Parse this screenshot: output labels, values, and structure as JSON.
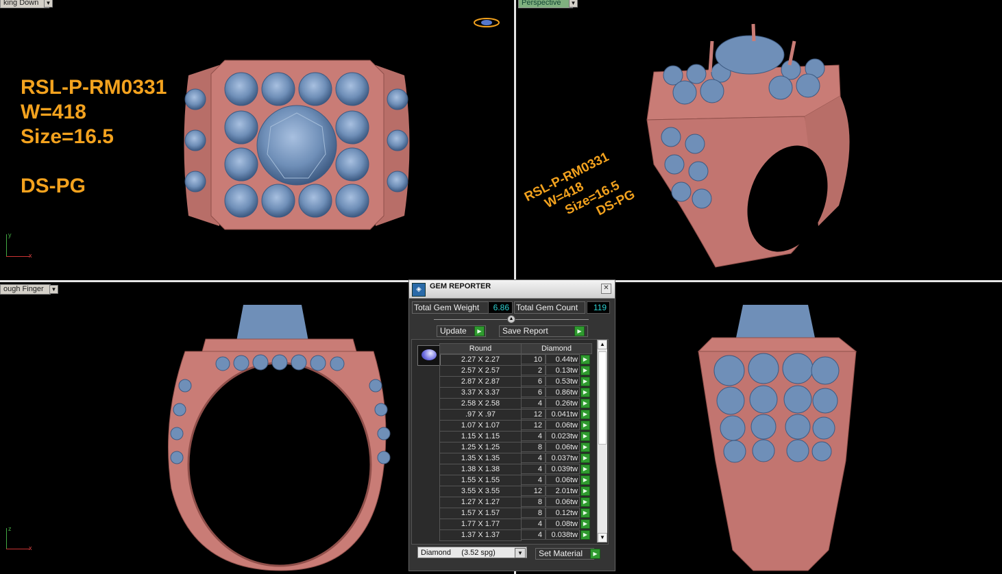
{
  "viewports": {
    "top_left_label": "king Down",
    "top_right_label": "Perspective",
    "bottom_left_label": "ough Finger"
  },
  "ring_info": {
    "code": "RSL-P-RM0331",
    "weight": "W=418",
    "size": "Size=16.5",
    "code2": "DS-PG"
  },
  "axis_labels": {
    "tl_y": "y",
    "tl_x": "x",
    "bl_z": "z",
    "bl_x": "x"
  },
  "gem_reporter": {
    "title": "GEM REPORTER",
    "total_weight_label": "Total Gem Weight",
    "total_weight_value": "6.86",
    "total_count_label": "Total Gem Count",
    "total_count_value": "119",
    "update_label": "Update",
    "save_report_label": "Save Report",
    "col_shape": "Round",
    "col_material": "Diamond",
    "rows": [
      {
        "size": "2.27 X 2.27",
        "count": "10",
        "weight": "0.44tw"
      },
      {
        "size": "2.57 X 2.57",
        "count": "2",
        "weight": "0.13tw"
      },
      {
        "size": "2.87 X 2.87",
        "count": "6",
        "weight": "0.53tw"
      },
      {
        "size": "3.37 X 3.37",
        "count": "6",
        "weight": "0.86tw"
      },
      {
        "size": "2.58 X 2.58",
        "count": "4",
        "weight": "0.26tw"
      },
      {
        "size": ".97 X .97",
        "count": "12",
        "weight": "0.041tw"
      },
      {
        "size": "1.07 X 1.07",
        "count": "12",
        "weight": "0.06tw"
      },
      {
        "size": "1.15 X 1.15",
        "count": "4",
        "weight": "0.023tw"
      },
      {
        "size": "1.25 X 1.25",
        "count": "8",
        "weight": "0.06tw"
      },
      {
        "size": "1.35 X 1.35",
        "count": "4",
        "weight": "0.037tw"
      },
      {
        "size": "1.38 X 1.38",
        "count": "4",
        "weight": "0.039tw"
      },
      {
        "size": "1.55 X 1.55",
        "count": "4",
        "weight": "0.06tw"
      },
      {
        "size": "3.55 X 3.55",
        "count": "12",
        "weight": "2.01tw"
      },
      {
        "size": "1.27 X 1.27",
        "count": "8",
        "weight": "0.06tw"
      },
      {
        "size": "1.57 X 1.57",
        "count": "8",
        "weight": "0.12tw"
      },
      {
        "size": "1.77 X 1.77",
        "count": "4",
        "weight": "0.08tw"
      },
      {
        "size": "1.37 X 1.37",
        "count": "4",
        "weight": "0.038tw"
      }
    ],
    "material_select": "Diamond     (3.52 spg)",
    "set_material_label": "Set Material"
  },
  "colors": {
    "metal": "#c97c76",
    "gem": "#6f8fb8",
    "annotation": "#f3a21e",
    "value_text": "#2ed1d1"
  }
}
